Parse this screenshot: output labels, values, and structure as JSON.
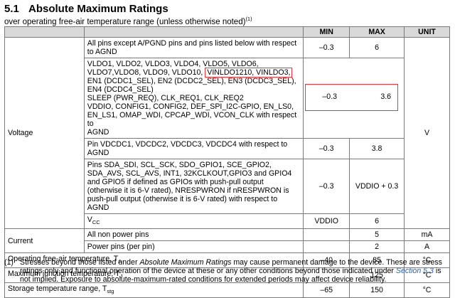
{
  "section": {
    "number": "5.1",
    "title": "Absolute Maximum Ratings"
  },
  "subtitle": {
    "text": "over operating free-air temperature range (unless otherwise noted)",
    "note_ref": "(1)"
  },
  "table": {
    "headers": {
      "min": "MIN",
      "max": "MAX",
      "unit": "UNIT"
    },
    "voltage": {
      "parameter": "Voltage",
      "unit": "V",
      "rows": [
        {
          "condition": "All pins except A/PGND pins and pins listed below with respect to AGND",
          "min": "–0.3",
          "max": "6"
        },
        {
          "condition_parts": [
            "VLDO1, VLDO2, VLDO3, VLDO4, VLDO5, VLDO6,",
            "VLDO7,VLDO8, VLDO9, VLDO10, ",
            "VINLDO1210, VINLDO3,",
            "EN1 (DCDC1_SEL), EN2 (DCDC2_SEL), EN3 (DCDC3_SEL),",
            "EN4 (DCDC4_SEL)",
            "SLEEP (PWR_REQ), CLK_REQ1, CLK_REQ2",
            "VDDIO, CONFIG1, CONFIG2, DEF_SPI_I2C-GPIO, EN_LS0,",
            "EN_LS1, OMAP_WDI, CPCAP_WDI, VCON_CLK with respect to",
            "AGND"
          ],
          "min": "–0.3",
          "max": "3.6"
        },
        {
          "condition": "Pin VDCDC1, VDCDC2, VDCDC3, VDCDC4 with respect to AGND",
          "min": "–0.3",
          "max": "3.8"
        },
        {
          "condition": "Pins SDA_SDI, SCL_SCK, SDO_GPIO1, SCE_GPIO2, SDA_AVS, SCL_AVS, INT1, 32KCLKOUT,GPIO3 and GPIO4 and GPIO5 if defined as GPIOs with push-pull output (otherwise it is 6-V rated), NRESPWRON if nRESPWRON is push-pull output (otherwise it is 6-V rated) with respect to AGND",
          "min": "–0.3",
          "max": "VDDIO + 0.3"
        },
        {
          "condition_main": "V",
          "condition_sub": "CC",
          "min": "VDDIO",
          "max": "6"
        }
      ]
    },
    "current": {
      "parameter": "Current",
      "rows": [
        {
          "condition": "All non power pins",
          "min": "",
          "max": "5",
          "unit": "mA"
        },
        {
          "condition": "Power pins (per pin)",
          "min": "",
          "max": "2",
          "unit": "A"
        }
      ]
    },
    "single_rows": [
      {
        "parameter": "Operating free-air temperature, T",
        "sub": "A",
        "min": "–40",
        "max": "85",
        "unit": "°C"
      },
      {
        "parameter": "Maximum junction temperature, T",
        "sub": "J",
        "min": "",
        "max": "125",
        "unit": "°C"
      },
      {
        "parameter": "Storage temperature range, T",
        "sub": "stg",
        "min": "–65",
        "max": "150",
        "unit": "°C"
      }
    ]
  },
  "footnote": {
    "marker": "(1)",
    "part1": "Stresses beyond those listed under ",
    "italic1": "Absolute Maximum Ratings",
    "part2": " may cause permanent damage to the device. These are stress ratings only and functional operation of the device at these or any other conditions beyond those indicated under ",
    "link": "Section 5.3",
    "part3": " is not implied. Exposure to absolute-maximum-rated conditions for extended periods may affect device reliability."
  },
  "highlight_color": "#e53935"
}
